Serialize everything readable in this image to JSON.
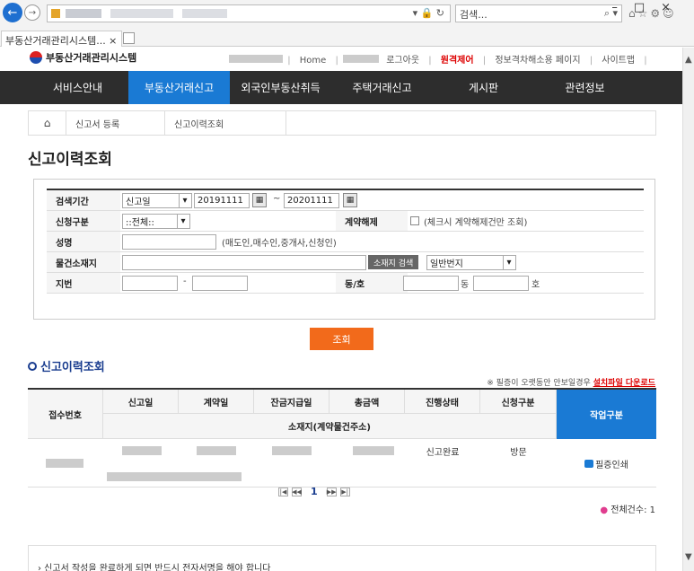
{
  "browser": {
    "search_placeholder": "검색...",
    "tab_title": "부동산거래관리시스템... ×"
  },
  "site": {
    "logo_text": "부동산거래관리시스템",
    "util": {
      "home": "Home",
      "logout": "로그아웃",
      "remote": "원격제어",
      "privacy": "정보격차해소용 페이지",
      "sitemap": "사이트맵"
    },
    "gnb": [
      "서비스안내",
      "부동산거래신고",
      "외국인부동산취득",
      "주택거래신고",
      "게시판",
      "관련정보"
    ],
    "gnb_active_index": 1,
    "breadcrumb": [
      "신고서 등록",
      "신고이력조회"
    ],
    "page_title": "신고이력조회"
  },
  "search": {
    "period_label": "검색기간",
    "period_type": "신고일",
    "date_from": "20191111",
    "tilde": "~",
    "date_to": "20201111",
    "apply_type_label": "신청구분",
    "apply_type_value": "::전체::",
    "cancel_label": "계약해제",
    "cancel_hint": "(체크시 계약해제건만 조회)",
    "name_label": "성명",
    "name_hint": "(매도인,매수인,중개사,신청인)",
    "location_label": "물건소재지",
    "location_button": "소재지 검색",
    "location_type": "일반번지",
    "jibun_label": "지번",
    "dash": "-",
    "dongho_label": "동/호",
    "dong_suffix": "동",
    "ho_suffix": "호",
    "submit_label": "조회"
  },
  "results": {
    "title": "신고이력조회",
    "notice_prefix": "※ 필증이 오랫동안 안보일경우",
    "notice_link": "설치파일 다운로드",
    "headers": {
      "receipt_no": "접수번호",
      "report_date": "신고일",
      "contract_date": "계약일",
      "balance_date": "잔금지급일",
      "total_amount": "총금액",
      "status": "진행상태",
      "apply_type": "신청구분",
      "action": "작업구분",
      "address": "소재지(계약물건주소)"
    },
    "rows": [
      {
        "status": "신고완료",
        "apply_type": "방문",
        "action": "필증인쇄"
      }
    ],
    "pager": {
      "first": "|◀",
      "prev": "◀◀",
      "current": "1",
      "next": "▶▶",
      "last": "▶|"
    },
    "total_label": "전체건수: 1"
  },
  "footer_notice": "› 신고서 작성을 완료하게 되면 반드시 전자서명을 해야 합니다"
}
